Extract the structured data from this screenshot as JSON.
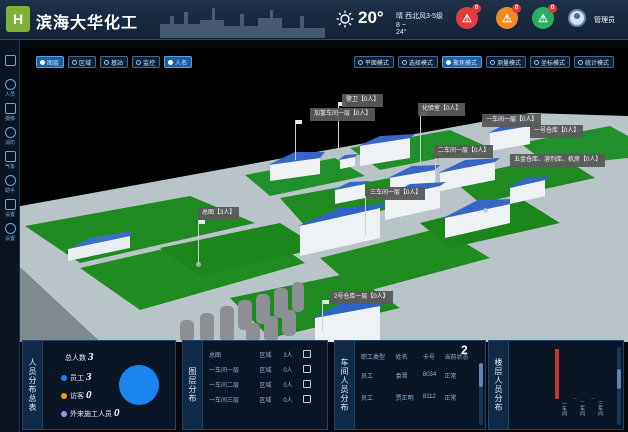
{
  "app": {
    "logo_text": "H",
    "title": "滨海大华化工"
  },
  "weather": {
    "temperature": "20°",
    "condition": "晴  西北风3-5级",
    "range": "8 ~ 24°"
  },
  "alarms": [
    {
      "name": "alarm-red",
      "count": "0",
      "color": "#e23b3b"
    },
    {
      "name": "alarm-orange",
      "count": "0",
      "color": "#f08a24"
    },
    {
      "name": "alarm-green",
      "count": "0",
      "color": "#27ae60"
    }
  ],
  "user": {
    "name": "管理员"
  },
  "nav": [
    {
      "label": "",
      "icon": "list-icon"
    },
    {
      "label": "人员",
      "icon": "person-icon"
    },
    {
      "label": "摄像",
      "icon": "camera-icon"
    },
    {
      "label": "消防",
      "icon": "fire-icon"
    },
    {
      "label": "气象",
      "icon": "cloud-icon"
    },
    {
      "label": "助手",
      "icon": "assistant-icon"
    },
    {
      "label": "设置",
      "icon": "settings-icon"
    },
    {
      "label": "设置",
      "icon": "gear-icon"
    }
  ],
  "toolbar_left": [
    {
      "label": "图层",
      "active": true
    },
    {
      "label": "区域",
      "active": false
    },
    {
      "label": "基站",
      "active": false
    },
    {
      "label": "监控",
      "active": false
    },
    {
      "label": "人名",
      "active": true
    }
  ],
  "toolbar_right": [
    {
      "label": "平面模式",
      "active": false
    },
    {
      "label": "选择模式",
      "active": false
    },
    {
      "label": "聚焦模式",
      "active": true
    },
    {
      "label": "测量模式",
      "active": false
    },
    {
      "label": "坐标模式",
      "active": false
    },
    {
      "label": "统计模式",
      "active": false
    }
  ],
  "scene_labels": [
    {
      "text": "警卫【0人】"
    },
    {
      "text": "加氢车间一层【0人】"
    },
    {
      "text": "化验室【0人】"
    },
    {
      "text": "一车间一层【0人】"
    },
    {
      "text": "一号仓库【0人】"
    },
    {
      "text": "二车间一层【0人】"
    },
    {
      "text": "五金仓库、溶剂库、机房【0人】"
    },
    {
      "text": "三车间一层【0人】"
    },
    {
      "text": "总图【3人】"
    },
    {
      "text": "2号仓库一层【0人】"
    }
  ],
  "personnel": {
    "title": "人员分布总表",
    "total_label": "总人数",
    "total": "3",
    "items": [
      {
        "label": "员工",
        "value": "3",
        "color": "#1c86f0"
      },
      {
        "label": "访客",
        "value": "0",
        "color": "#f39c12"
      },
      {
        "label": "外来施工人员",
        "value": "0",
        "color": "#b28be8"
      }
    ]
  },
  "layers": {
    "title": "图层分布",
    "rows": [
      [
        "总图",
        "区域",
        "3人"
      ],
      [
        "一车间一层",
        "区域",
        "0人"
      ],
      [
        "一车间二层",
        "区域",
        "0人"
      ],
      [
        "一车间三层",
        "区域",
        "0人"
      ]
    ]
  },
  "workshop": {
    "title": "车间人员分布",
    "headers": [
      "职工类型",
      "姓名",
      "卡号",
      "当前状态"
    ],
    "rows": [
      [
        "员工",
        "袁晋",
        "8034",
        "正常"
      ],
      [
        "员工",
        "贾正明",
        "8112",
        "正常"
      ]
    ],
    "count": "2"
  },
  "floors": {
    "title": "楼层人员分布",
    "labels": [
      "一车间",
      "二车间",
      "三车间"
    ],
    "values": [
      3,
      0,
      0
    ],
    "bar_color": "#c0392b"
  }
}
